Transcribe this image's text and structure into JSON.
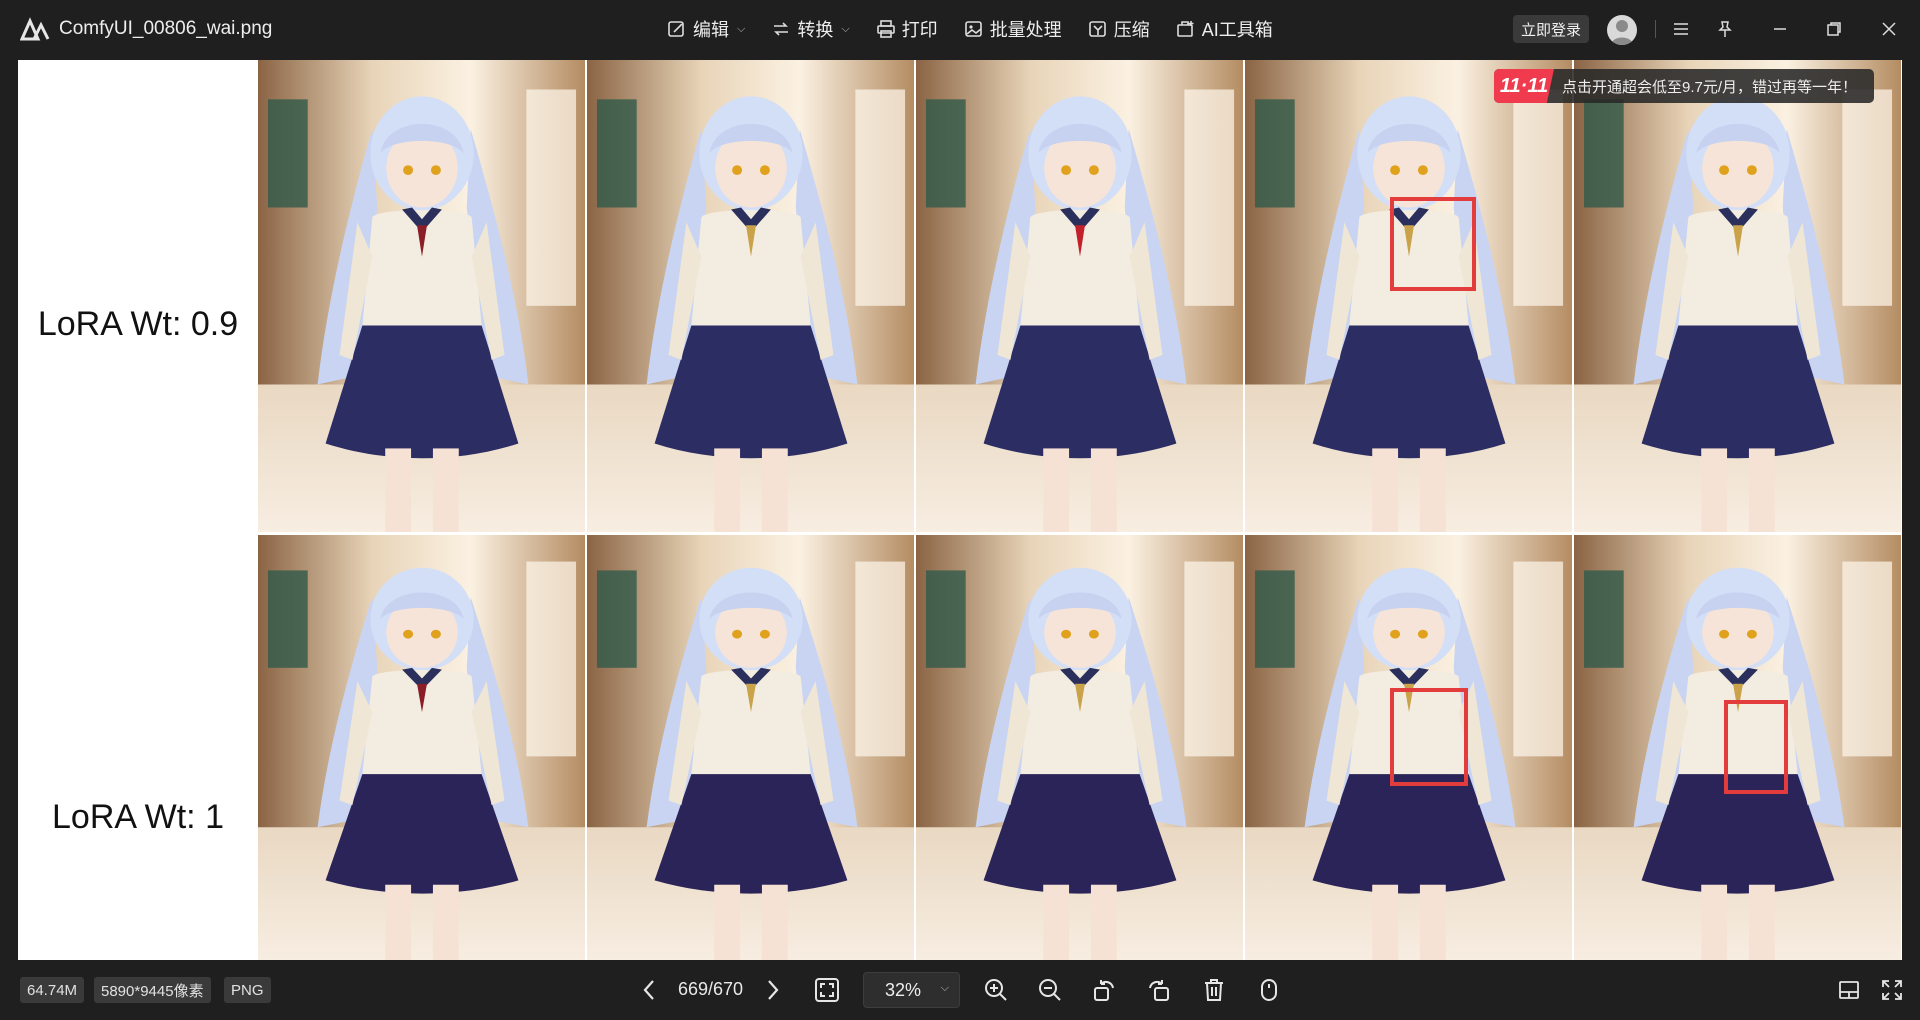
{
  "titlebar": {
    "file_name": "ComfyUI_00806_wai.png",
    "menu": [
      {
        "label": "编辑",
        "icon": "edit-icon",
        "has_caret": true
      },
      {
        "label": "转换",
        "icon": "convert-icon",
        "has_caret": true
      },
      {
        "label": "打印",
        "icon": "print-icon",
        "has_caret": false
      },
      {
        "label": "批量处理",
        "icon": "batch-icon",
        "has_caret": false
      },
      {
        "label": "压缩",
        "icon": "compress-icon",
        "has_caret": false
      },
      {
        "label": "AI工具箱",
        "icon": "ai-toolbox-icon",
        "has_caret": false
      }
    ],
    "login_label": "立即登录"
  },
  "image": {
    "row_labels": [
      "LoRA Wt: 0.9",
      "LoRA Wt: 1"
    ],
    "rows": 2,
    "columns": 5
  },
  "promo": {
    "badge": "11·11",
    "text": "点击开通超会低至9.7元/月，错过再等一年！"
  },
  "statusbar": {
    "file_size": "64.74M",
    "dimensions": "5890*9445像素",
    "format": "PNG",
    "page_counter": "669/670",
    "zoom": "32%"
  },
  "colors": {
    "background": "#1f1f1f",
    "highlight_box": "#e33c3c",
    "promo_badge": "#ef3b4d"
  }
}
